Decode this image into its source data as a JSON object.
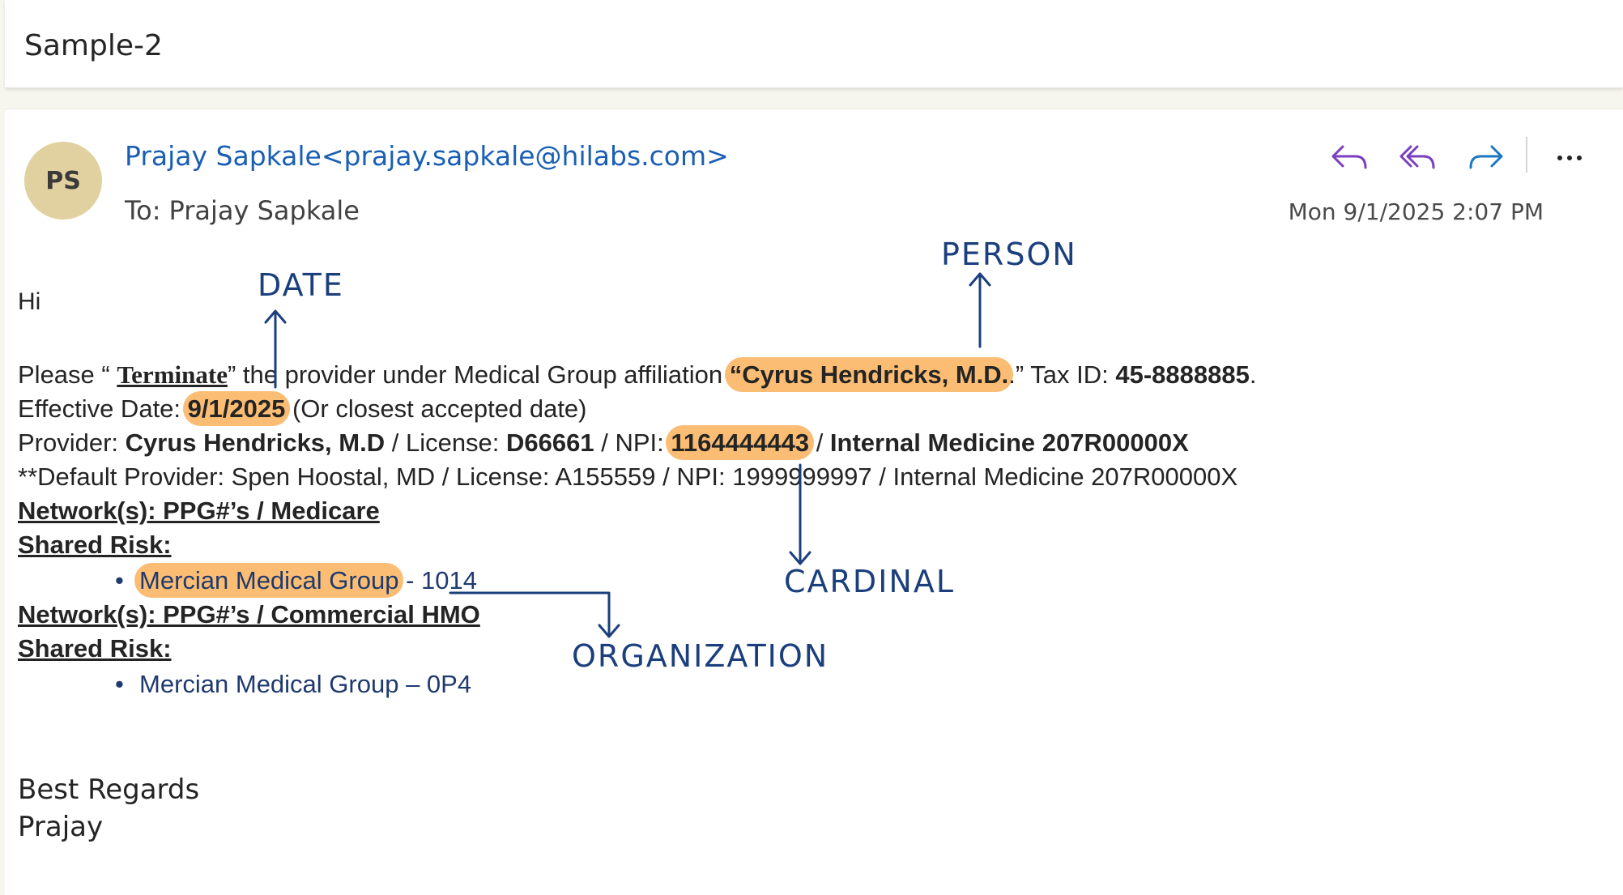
{
  "subject": "Sample-2",
  "sender": {
    "initials": "PS",
    "display": "Prajay Sapkale<prajay.sapkale@hilabs.com>"
  },
  "recipients": {
    "label": "To:",
    "name": "Prajay Sapkale"
  },
  "timestamp": "Mon 9/1/2025 2:07 PM",
  "actions": {
    "reply": "reply-icon",
    "reply_all": "reply-all-icon",
    "forward": "forward-icon",
    "more": "more-icon"
  },
  "body": {
    "greeting": "Hi",
    "line1": {
      "p1": "Please “ ",
      "terminate": "Terminate",
      "p2": "” the provider under Medical Group affiliation ",
      "person": "“Cyrus Hendricks, M.D.",
      "p3": ".” Tax ID: ",
      "tax_id": "45-8888885",
      "p4": "."
    },
    "line2": {
      "p1": "Effective Date: ",
      "date": "9/1/2025",
      "p2": " (Or closest accepted date)"
    },
    "line3": {
      "p1": "Provider: ",
      "provider": "Cyrus Hendricks, M.D",
      "p2": " / License: ",
      "license": "D66661",
      "p3": " / NPI: ",
      "npi": "1164444443",
      "p4": " / ",
      "specialty": "Internal Medicine 207R00000X"
    },
    "line4": "**Default Provider: Spen Hoostal, MD / License: A155559 / NPI: 1999999997 / Internal Medicine 207R00000X",
    "network1": "Network(s): PPG#’s / Medicare",
    "shared_risk1": "Shared Risk:",
    "item1": {
      "org": "Mercian Medical Group",
      "rest": " - 1014"
    },
    "network2": "Network(s): PPG#’s / Commercial HMO",
    "shared_risk2": "Shared Risk:",
    "item2": "Mercian Medical Group – 0P4",
    "closing": "Best Regards",
    "signature": "Prajay"
  },
  "annotations": {
    "date": "DATE",
    "person": "PERSON",
    "cardinal": "CARDINAL",
    "organization": "ORGANIZATION"
  },
  "colors": {
    "highlight": "#fbbd73",
    "annotation_ink": "#1b3f7d",
    "sender_link": "#1a5fb4",
    "action_icons": "#7a3fbf"
  }
}
